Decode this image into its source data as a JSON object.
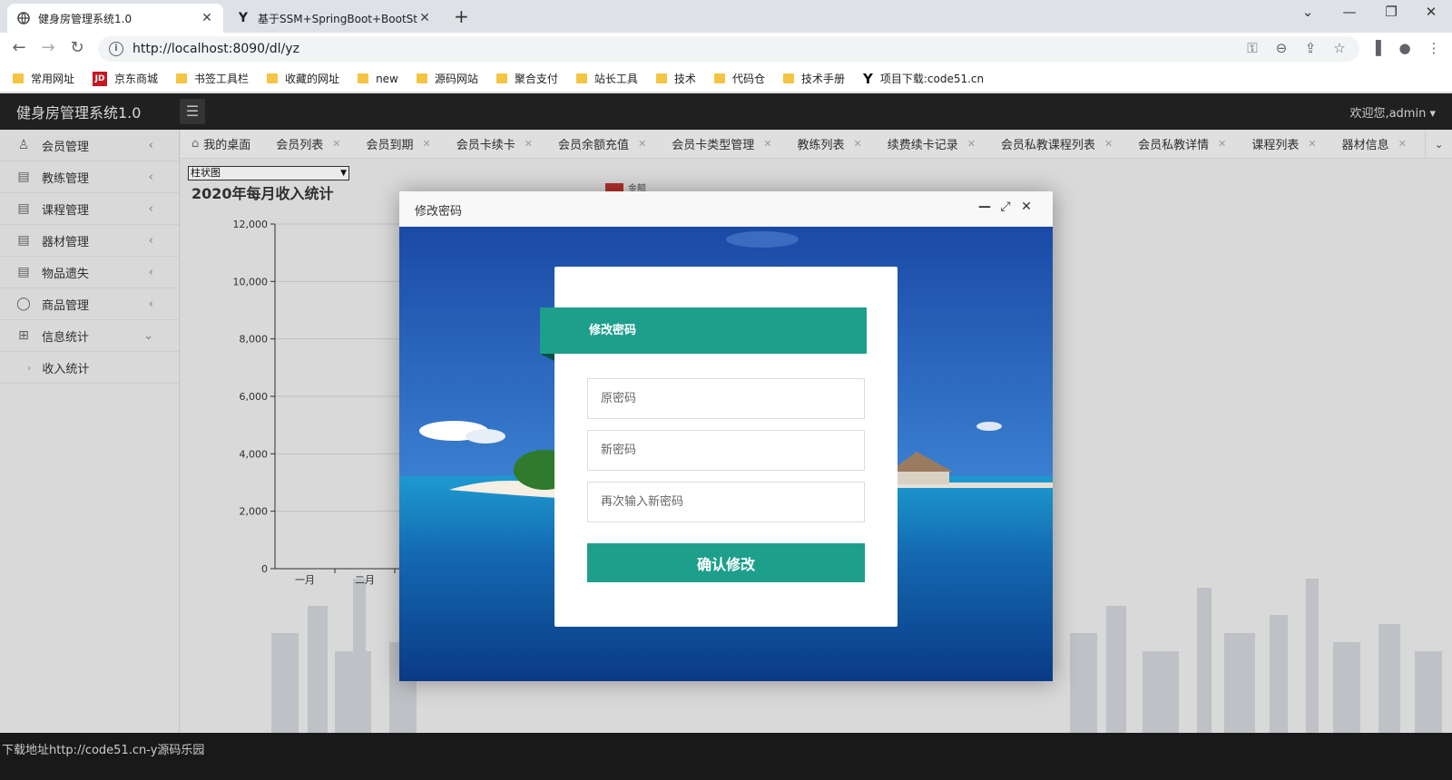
{
  "browser": {
    "tabs": [
      {
        "title": "健身房管理系统1.0",
        "active": true
      },
      {
        "title": "基于SSM+SpringBoot+BootSt",
        "active": false
      }
    ],
    "url": "http://localhost:8090/dl/yz",
    "bookmarks": [
      "常用网址",
      "京东商城",
      "书签工具栏",
      "收藏的网址",
      "new",
      "源码网站",
      "聚合支付",
      "站长工具",
      "技术",
      "代码仓",
      "技术手册",
      "项目下载:code51.cn"
    ]
  },
  "app": {
    "title": "健身房管理系统1.0",
    "welcome": "欢迎您,admin"
  },
  "sidebar": {
    "items": [
      {
        "label": "会员管理",
        "icon": "user-icon"
      },
      {
        "label": "教练管理",
        "icon": "document-icon"
      },
      {
        "label": "课程管理",
        "icon": "document-icon"
      },
      {
        "label": "器材管理",
        "icon": "document-icon"
      },
      {
        "label": "物品遗失",
        "icon": "document-icon"
      },
      {
        "label": "商品管理",
        "icon": "gift-icon"
      },
      {
        "label": "信息统计",
        "icon": "grid-icon"
      }
    ],
    "subitems": [
      {
        "label": "收入统计"
      }
    ]
  },
  "page_tabs": [
    "我的桌面",
    "会员列表",
    "会员到期",
    "会员卡续卡",
    "会员余额充值",
    "会员卡类型管理",
    "教练列表",
    "续费续卡记录",
    "会员私教课程列表",
    "会员私教详情",
    "课程列表",
    "器材信息"
  ],
  "chart": {
    "select_value": "柱状图",
    "legend": "金额"
  },
  "chart_data": {
    "type": "bar",
    "title": "2020年每月收入统计",
    "categories": [
      "一月",
      "二月"
    ],
    "yticks": [
      "0",
      "2,000",
      "4,000",
      "6,000",
      "8,000",
      "10,000",
      "12,000"
    ],
    "ylim": [
      0,
      12000
    ],
    "series": [
      {
        "name": "金额",
        "values": [
          0,
          0
        ]
      }
    ]
  },
  "footer": {
    "text": "下载地址http://code51.cn-y源码乐园"
  },
  "modal": {
    "title": "修改密码",
    "form_title": "修改密码",
    "old_password_placeholder": "原密码",
    "new_password_placeholder": "新密码",
    "confirm_password_placeholder": "再次输入新密码",
    "submit_label": "确认修改"
  }
}
